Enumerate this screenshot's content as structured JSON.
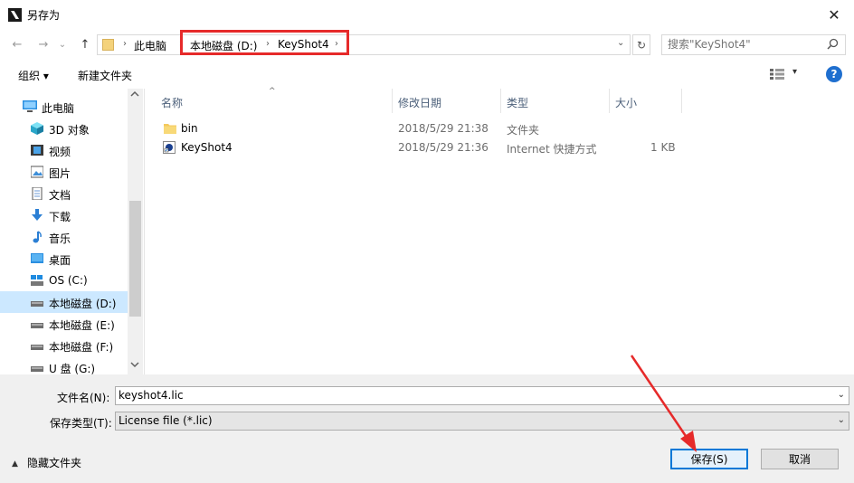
{
  "window": {
    "title": "另存为",
    "close": "✕"
  },
  "nav": {
    "back": "←",
    "forward": "→",
    "recent": "⌄",
    "up": "↑"
  },
  "address": {
    "crumbs": [
      "此电脑",
      "本地磁盘 (D:)",
      "KeyShot4"
    ],
    "separator": "›",
    "dropdown": "⌄",
    "refresh": "↻"
  },
  "search": {
    "placeholder": "搜索\"KeyShot4\""
  },
  "toolbar": {
    "organize": "组织 ▾",
    "new_folder": "新建文件夹",
    "view_dropdown": "▾",
    "help": "?"
  },
  "sidebar": {
    "items": [
      {
        "label": "此电脑",
        "icon": "computer-icon"
      },
      {
        "label": "3D 对象",
        "icon": "3d-objects-icon"
      },
      {
        "label": "视频",
        "icon": "video-icon"
      },
      {
        "label": "图片",
        "icon": "pictures-icon"
      },
      {
        "label": "文档",
        "icon": "documents-icon"
      },
      {
        "label": "下载",
        "icon": "download-icon"
      },
      {
        "label": "音乐",
        "icon": "music-icon"
      },
      {
        "label": "桌面",
        "icon": "desktop-icon"
      },
      {
        "label": "OS (C:)",
        "icon": "os-drive-icon"
      },
      {
        "label": "本地磁盘 (D:)",
        "icon": "drive-icon",
        "selected": true
      },
      {
        "label": "本地磁盘 (E:)",
        "icon": "drive-icon"
      },
      {
        "label": "本地磁盘 (F:)",
        "icon": "drive-icon"
      },
      {
        "label": "U 盘 (G:)",
        "icon": "usb-drive-icon"
      }
    ]
  },
  "filelist": {
    "columns": [
      "名称",
      "修改日期",
      "类型",
      "大小"
    ],
    "sort_indicator": "^",
    "rows": [
      {
        "name": "bin",
        "date": "2018/5/29 21:38",
        "type": "文件夹",
        "size": "",
        "icon": "folder-icon"
      },
      {
        "name": "KeyShot4",
        "date": "2018/5/29 21:36",
        "type": "Internet 快捷方式",
        "size": "1 KB",
        "icon": "internet-shortcut-icon"
      }
    ]
  },
  "form": {
    "filename_label": "文件名(N):",
    "filename_value": "keyshot4.lic",
    "filetype_label": "保存类型(T):",
    "filetype_value": "License file (*.lic)",
    "dropdown": "⌄"
  },
  "footer": {
    "hide_folders_arrow": "▲",
    "hide_folders": "隐藏文件夹",
    "save": "保存(S)",
    "cancel": "取消"
  },
  "colors": {
    "accent": "#0078d7",
    "highlight": "#e62a2a",
    "selected_bg": "#cce8ff"
  }
}
